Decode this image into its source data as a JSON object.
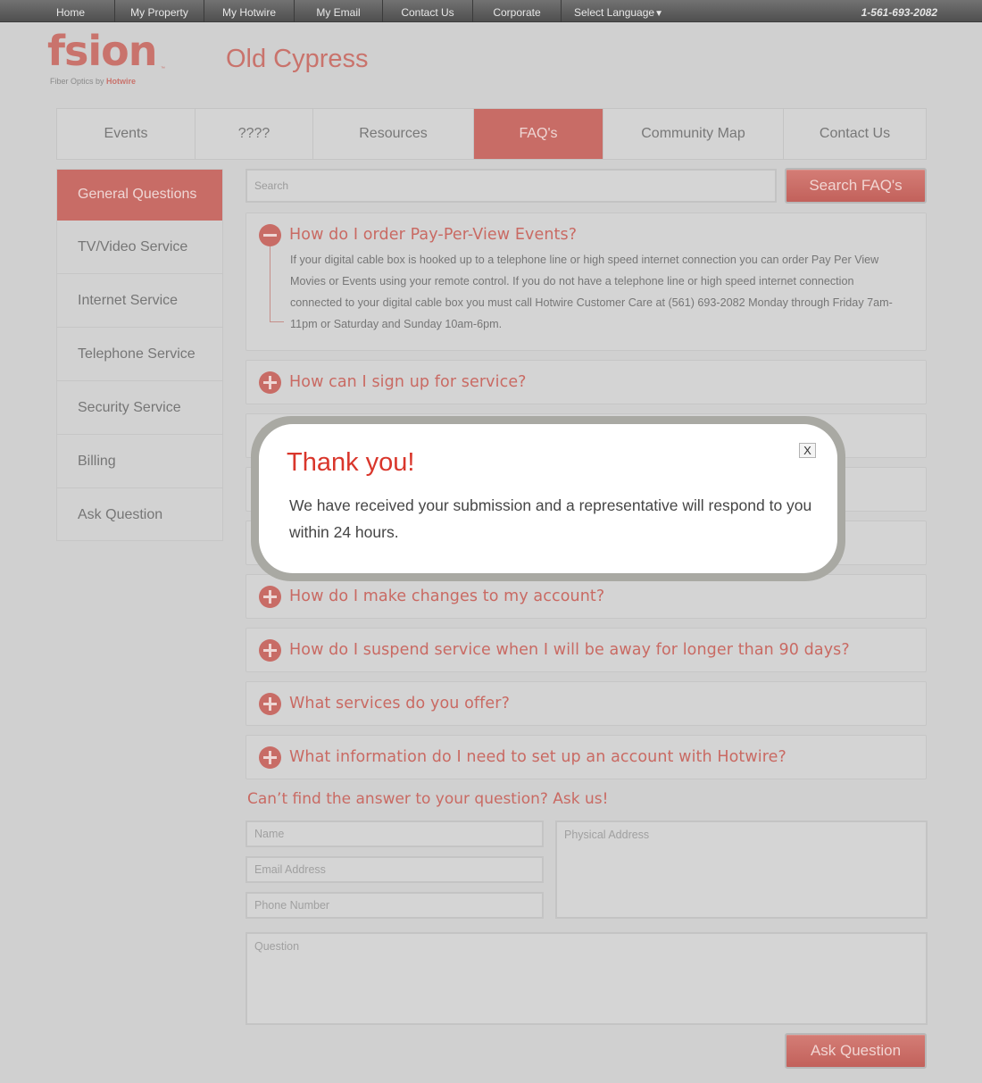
{
  "topnav": {
    "items": [
      "Home",
      "My Property",
      "My Hotwire",
      "My Email",
      "Contact Us",
      "Corporate"
    ],
    "language": "Select Language",
    "phone": "1-561-693-2082"
  },
  "header": {
    "logo_word": "fsion",
    "logo_tm": "™",
    "logo_tagline_prefix": "Fiber Optics by ",
    "logo_tagline_brand": "Hotwire",
    "site_title": "Old Cypress"
  },
  "tabs": [
    {
      "label": "Events"
    },
    {
      "label": "????"
    },
    {
      "label": "Resources"
    },
    {
      "label": "FAQ's"
    },
    {
      "label": "Community Map"
    },
    {
      "label": "Contact Us"
    }
  ],
  "sidebar": {
    "items": [
      {
        "label": "General Questions"
      },
      {
        "label": "TV/Video Service"
      },
      {
        "label": "Internet Service"
      },
      {
        "label": "Telephone Service"
      },
      {
        "label": "Security Service"
      },
      {
        "label": "Billing"
      },
      {
        "label": "Ask Question"
      }
    ]
  },
  "search": {
    "placeholder": "Search",
    "button_label": "Search FAQ's"
  },
  "faqs": [
    {
      "question": "How do I order Pay-Per-View Events?",
      "expanded": true,
      "answer": "If your digital cable box is hooked up to a telephone line or high speed internet connection you can order Pay Per View Movies or Events using your remote control. If you do not have a telephone line or high speed internet connection connected to your digital cable box you must call Hotwire Customer Care at (561) 693-2082 Monday through Friday 7am-11pm or Saturday and Sunday 10am-6pm."
    },
    {
      "question": "How can I sign up for service?",
      "expanded": false
    },
    {
      "question": "How do I make changes to my account?",
      "expanded": false
    },
    {
      "question": "How do I suspend service when I will be away for longer than 90 days?",
      "expanded": false
    },
    {
      "question": "What services do you offer?",
      "expanded": false
    },
    {
      "question": "What information do I need to set up an account with Hotwire?",
      "expanded": false
    }
  ],
  "ask_form": {
    "title": "Can’t find the answer to your question? Ask us!",
    "name_placeholder": "Name",
    "email_placeholder": "Email Address",
    "phone_placeholder": "Phone Number",
    "address_placeholder": "Physical Address",
    "question_placeholder": "Question",
    "submit_label": "Ask Question"
  },
  "modal": {
    "title": "Thank you!",
    "body": "We have received your submission and a representative will respond to you within 24 hours.",
    "close_label": "X"
  },
  "colors": {
    "brand": "#c86c66",
    "modal_title": "#d9362b",
    "overlay_bg": "#d0d0d0"
  }
}
